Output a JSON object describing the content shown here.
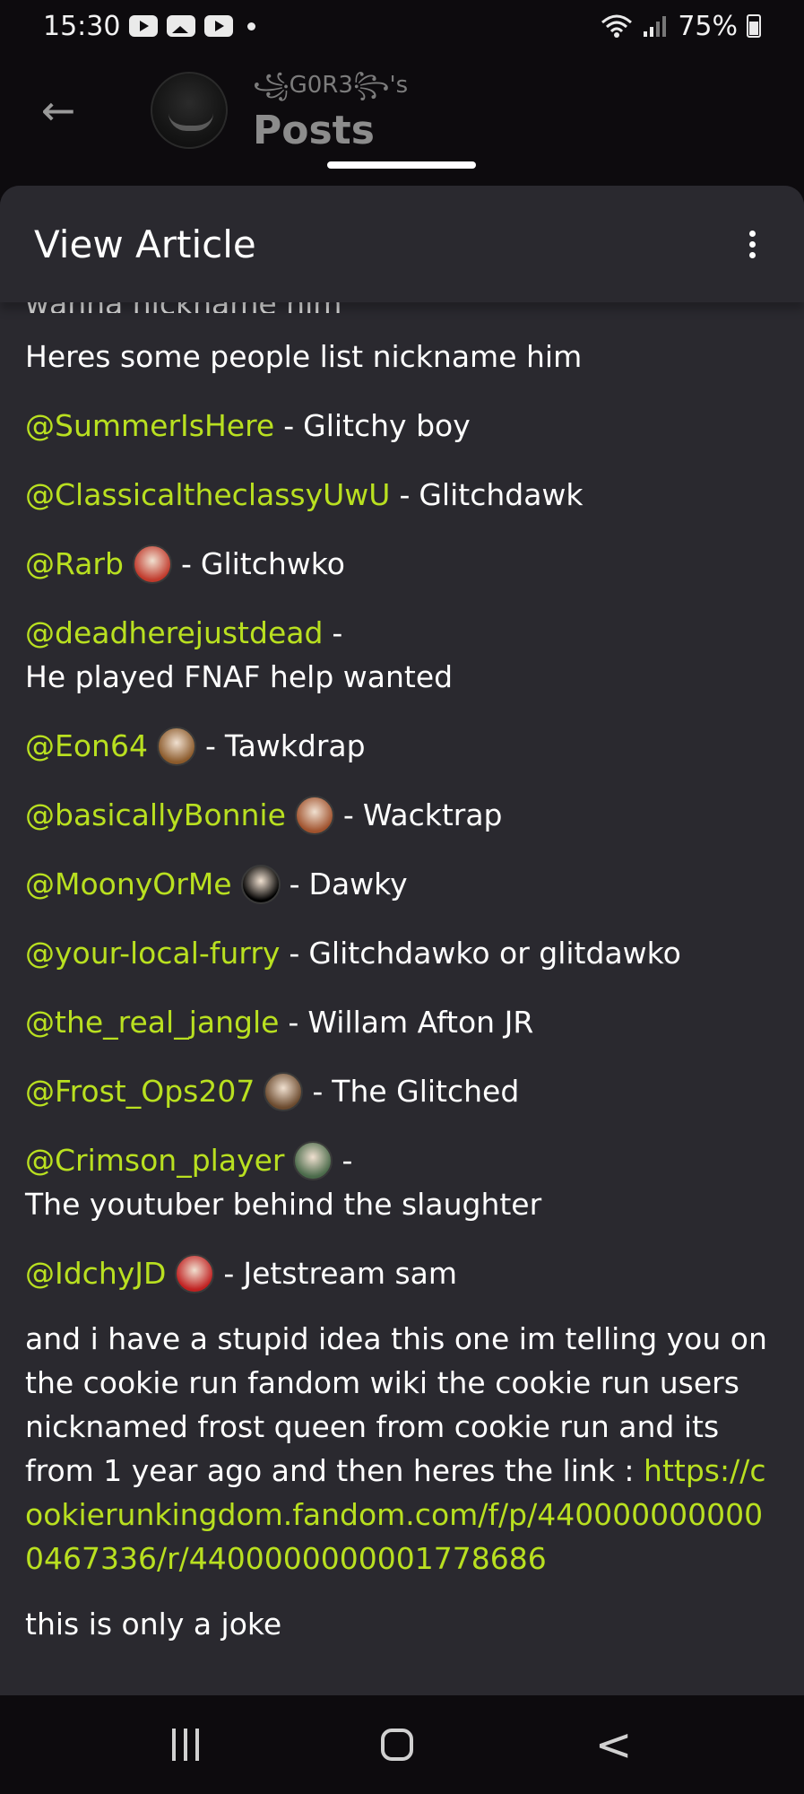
{
  "status_bar": {
    "time": "15:30",
    "battery": "75%",
    "icons": [
      "youtube-icon",
      "gallery-icon",
      "youtube-icon",
      "dot-icon",
      "wifi-icon",
      "signal-icon",
      "battery-icon"
    ]
  },
  "header": {
    "owner": "꧁G0R3꧂'s",
    "title": "Posts"
  },
  "sheet": {
    "title": "View Article"
  },
  "article": {
    "cut_text": "wanna nickname him",
    "intro": "Heres some people list nickname him",
    "nicknames": [
      {
        "user": "@SummerIsHere",
        "nick": "Glitchy boy",
        "avatar_color": ""
      },
      {
        "user": "@ClassicaltheclassyUwU",
        "nick": "Glitchdawk",
        "avatar_color": ""
      },
      {
        "user": "@Rarb",
        "nick": "Glitchwko",
        "avatar_color": "#c0392b"
      },
      {
        "user": "@deadherejustdead",
        "nick": "He played FNAF help wanted",
        "avatar_color": ""
      },
      {
        "user": "@Eon64",
        "nick": "Tawkdrap",
        "avatar_color": "#8b5a2b"
      },
      {
        "user": "@basicallyBonnie",
        "nick": "Wacktrap",
        "avatar_color": "#a0522d"
      },
      {
        "user": "@MoonyOrMe",
        "nick": " Dawky",
        "avatar_color": "#000000"
      },
      {
        "user": "@your-local-furry",
        "nick": "Glitchdawko or glitdawko",
        "avatar_color": ""
      },
      {
        "user": "@the_real_jangle",
        "nick": "Willam Afton JR",
        "avatar_color": ""
      },
      {
        "user": "@Frost_Ops207",
        "nick": "The Glitched",
        "avatar_color": "#6b4a2e"
      },
      {
        "user": "@Crimson_player",
        "nick": "The youtuber behind the slaughter",
        "avatar_color": "#4a6a4a"
      },
      {
        "user": "@IdchyJD",
        "nick": "Jetstream sam",
        "avatar_color": "#c02020"
      }
    ],
    "body_text": "and i have a stupid idea this one im telling you on the cookie run fandom wiki the cookie run users nicknamed frost queen from cookie run and its from 1 year ago and then heres the link :",
    "link": "https://cookierunkingdom.fandom.com/f/p/4400000000000467336/r/4400000000001778686",
    "closing": "this is only a joke"
  },
  "colors": {
    "mention": "#b9e020",
    "sheet_bg": "#2a292f",
    "page_bg": "#0d0b0e"
  }
}
